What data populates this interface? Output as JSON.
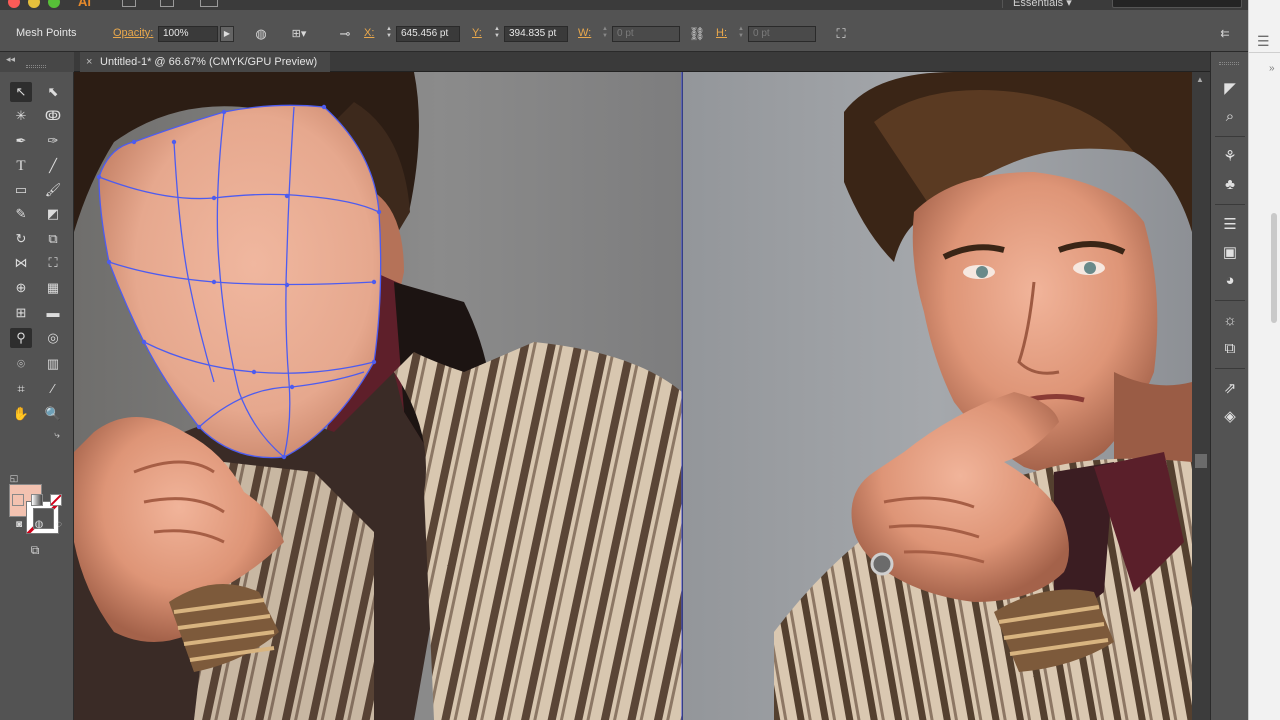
{
  "app": {
    "badge": "Ai",
    "workspace": "Essentials"
  },
  "controlbar": {
    "selection_label": "Mesh Points",
    "opacity_label": "Opacity:",
    "opacity_value": "100%",
    "x_label": "X:",
    "x_value": "645.456 pt",
    "y_label": "Y:",
    "y_value": "394.835 pt",
    "w_label": "W:",
    "w_value": "0 pt",
    "h_label": "H:",
    "h_value": "0 pt"
  },
  "document": {
    "tab_title": "Untitled-1* @ 66.67% (CMYK/GPU Preview)",
    "close_glyph": "×"
  },
  "colors": {
    "fill_swatch": "#f3c2b0",
    "mesh_stroke": "#4d5cf0",
    "accent_label": "#e9a84c"
  },
  "tools": {
    "type_glyph": "T",
    "fill_mode_icons": [
      "color-icon",
      "gradient-icon",
      "none-icon"
    ]
  }
}
